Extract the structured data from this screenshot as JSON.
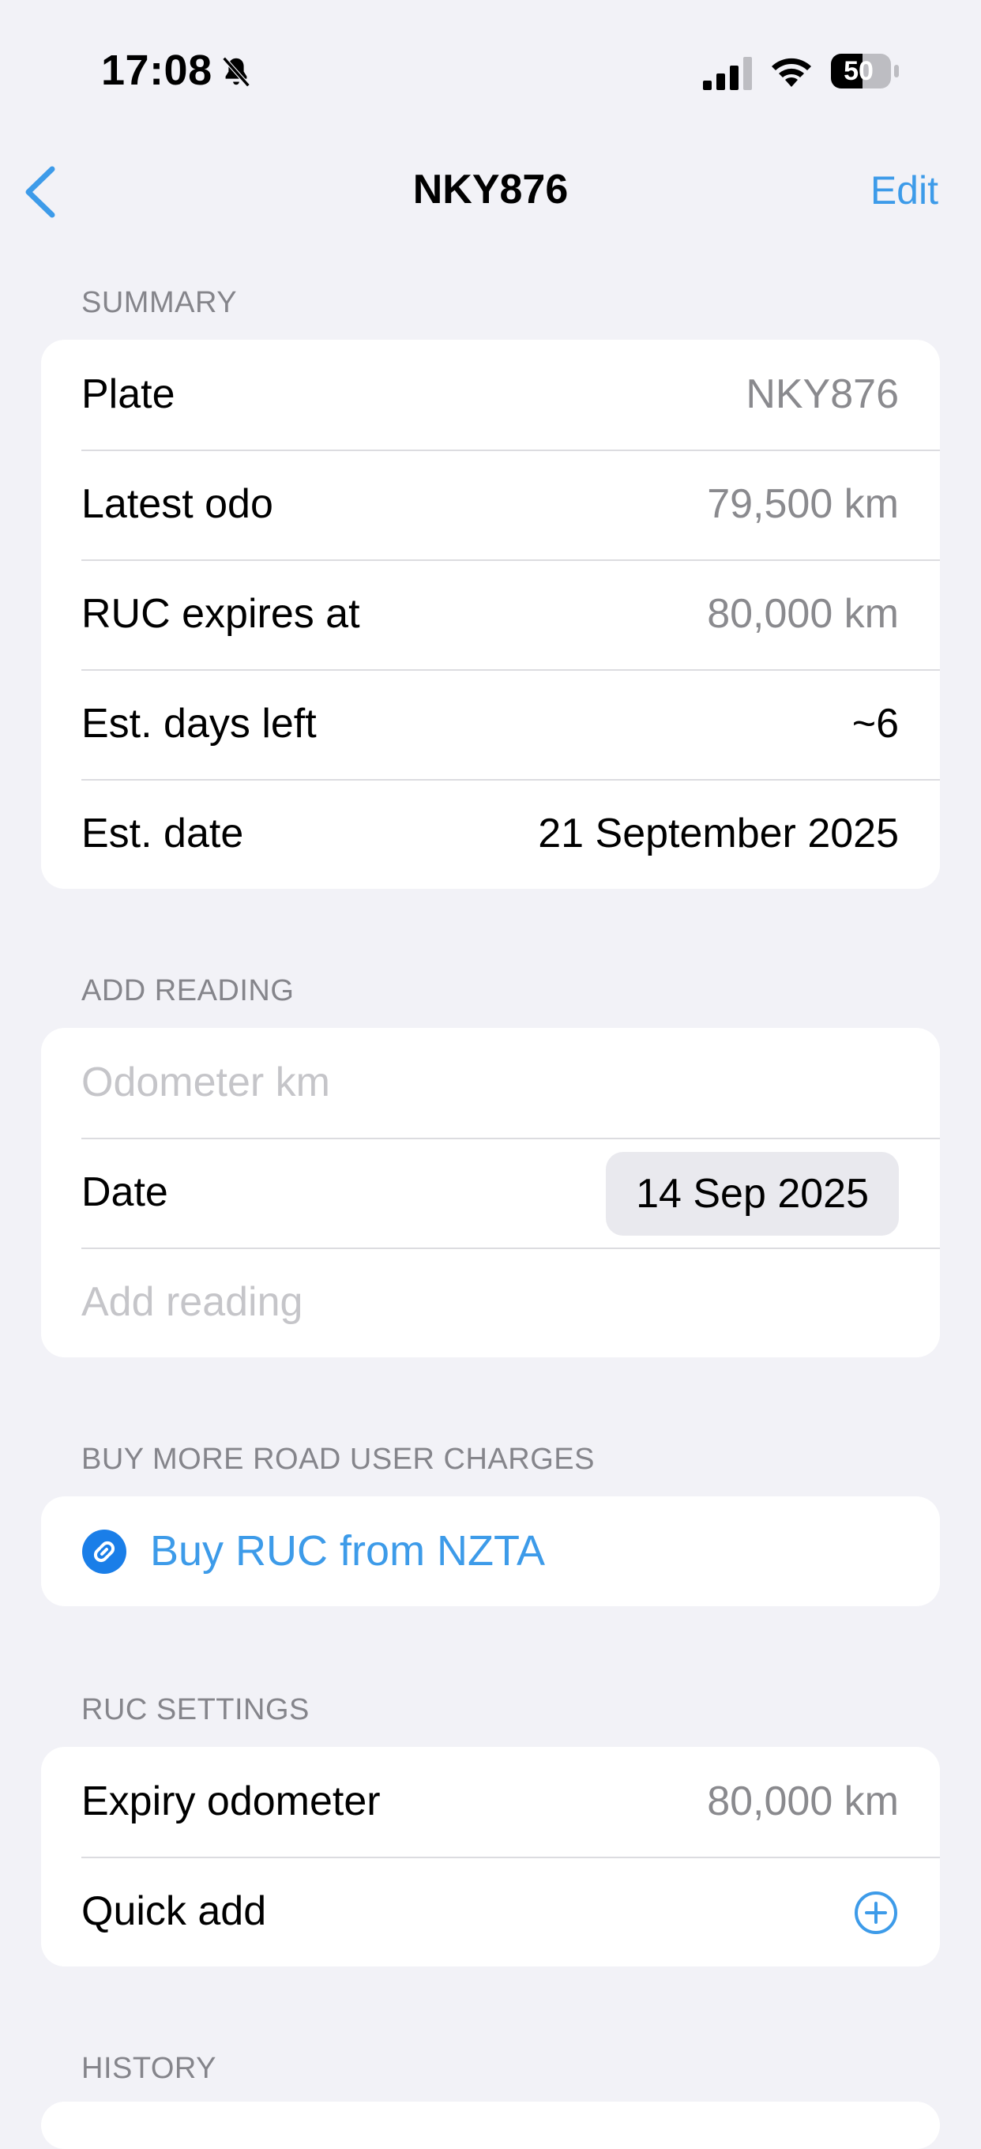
{
  "status_bar": {
    "time": "17:08",
    "battery": "50",
    "icons": [
      "bell-slash-icon",
      "signal-icon",
      "wifi-icon",
      "battery-icon"
    ]
  },
  "nav": {
    "title": "NKY876",
    "edit_label": "Edit",
    "back_icon": "chevron-left-icon"
  },
  "summary": {
    "header": "SUMMARY",
    "rows": [
      {
        "label": "Plate",
        "value": "NKY876"
      },
      {
        "label": "Latest odo",
        "value": "79,500 km"
      },
      {
        "label": "RUC expires at",
        "value": "80,000 km"
      },
      {
        "label": "Est. days left",
        "value": "~6"
      },
      {
        "label": "Est. date",
        "value": "21 September 2025"
      }
    ]
  },
  "add_reading": {
    "header": "ADD READING",
    "odometer_placeholder": "Odometer km",
    "date_label": "Date",
    "date_value": "14 Sep 2025",
    "add_label": "Add reading"
  },
  "buy": {
    "header": "BUY MORE ROAD USER CHARGES",
    "link_label": "Buy RUC from NZTA",
    "icon": "link-icon"
  },
  "settings": {
    "header": "RUC SETTINGS",
    "expiry_label": "Expiry odometer",
    "expiry_value": "80,000 km",
    "quick_add_label": "Quick add",
    "quick_add_icon": "plus-circle-icon"
  },
  "history": {
    "header": "HISTORY"
  },
  "colors": {
    "background": "#f2f2f7",
    "accent": "#3d9be9",
    "link_icon_bg": "#1a7ee8",
    "secondary_text": "#8a8a8e"
  }
}
